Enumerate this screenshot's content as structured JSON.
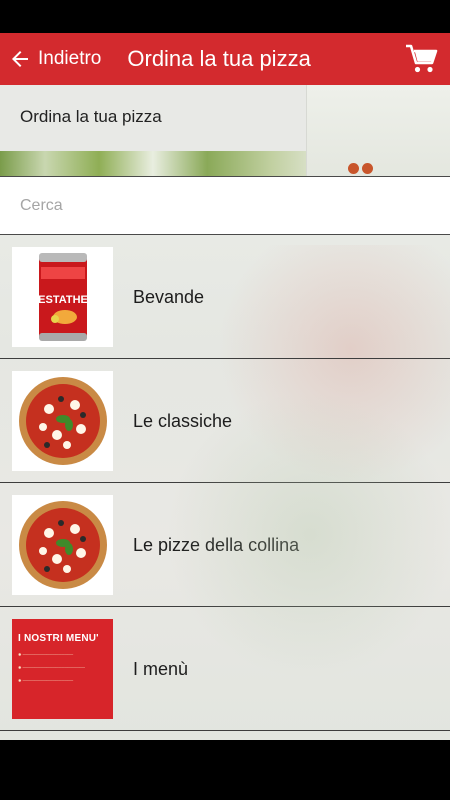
{
  "header": {
    "back_label": "Indietro",
    "title": "Ordina la tua pizza",
    "background_color": "#d32a2e",
    "back_icon": "arrow-left-icon",
    "cart_icon": "cart-icon"
  },
  "page": {
    "heading": "Ordina la tua pizza"
  },
  "search": {
    "placeholder": "Cerca"
  },
  "categories": [
    {
      "label": "Bevande",
      "image": "can-drink-image"
    },
    {
      "label": "Le classiche",
      "image": "pizza-image"
    },
    {
      "label": "Le pizze della collina",
      "image": "pizza-image"
    },
    {
      "label": "I menù",
      "image": "menu-card-image"
    }
  ],
  "drink_can": {
    "brand": "ESTATHE"
  },
  "menu_card": {
    "title": "I NOSTRI MENU'"
  }
}
